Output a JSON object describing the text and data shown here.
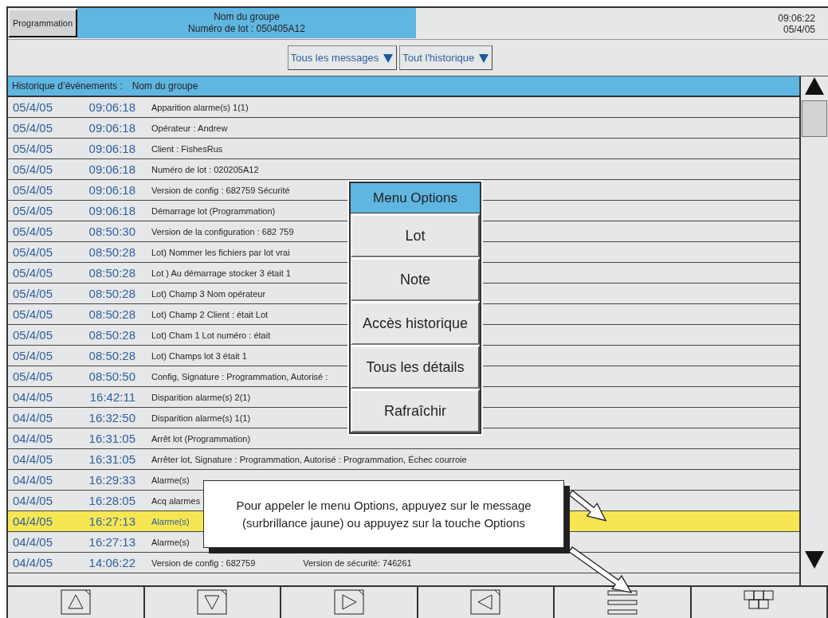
{
  "header": {
    "program_button": "Programmation",
    "group_name": "Nom du groupe",
    "batch_number": "Numéro de lot : 050405A12",
    "time": "09:06:22",
    "date": "05/4/05"
  },
  "filters": [
    {
      "label": "Tous les messages"
    },
    {
      "label": "Tout l'historique"
    }
  ],
  "table": {
    "title": "Historique d’événements :",
    "group": "Nom du groupe",
    "rows": [
      {
        "date": "05/4/05",
        "time": "09:06:18",
        "message": "Apparition alarme(s) 1(1)",
        "selected": false
      },
      {
        "date": "05/4/05",
        "time": "09:06:18",
        "message": "Opérateur : Andrew",
        "selected": false
      },
      {
        "date": "05/4/05",
        "time": "09:06:18",
        "message": "Client : FishesRus",
        "selected": false
      },
      {
        "date": "05/4/05",
        "time": "09:06:18",
        "message": "Numéro de lot : 020205A12",
        "selected": false
      },
      {
        "date": "05/4/05",
        "time": "09:06:18",
        "message": "Version de config : 682759 Sécurité",
        "selected": false
      },
      {
        "date": "05/4/05",
        "time": "09:06:18",
        "message": "Démarrage lot (Programmation)",
        "selected": false
      },
      {
        "date": "05/4/05",
        "time": "08:50:30",
        "message": "Version de la configuration : 682 759",
        "selected": false
      },
      {
        "date": "05/4/05",
        "time": "08:50:28",
        "message": "Lot) Nommer les fichiers par lot vrai",
        "selected": false
      },
      {
        "date": "05/4/05",
        "time": "08:50:28",
        "message": "Lot ) Au démarrage stocker 3 était 1",
        "selected": false
      },
      {
        "date": "05/4/05",
        "time": "08:50:28",
        "message": "Lot) Champ 3 Nom opérateur",
        "selected": false
      },
      {
        "date": "05/4/05",
        "time": "08:50:28",
        "message": "Lot) Champ 2 Client : était Lot",
        "selected": false
      },
      {
        "date": "05/4/05",
        "time": "08:50:28",
        "message": "Lot) Cham 1 Lot numéro : était",
        "selected": false
      },
      {
        "date": "05/4/05",
        "time": "08:50:28",
        "message": "Lot) Champs lot 3 était 1",
        "selected": false
      },
      {
        "date": "05/4/05",
        "time": "08:50:50",
        "message": "Config, Signature : Programmation, Autorisé :",
        "selected": false
      },
      {
        "date": "04/4/05",
        "time": "16:42:11",
        "message": "Disparition alarme(s) 2(1)",
        "selected": false
      },
      {
        "date": "04/4/05",
        "time": "16:32:50",
        "message": "Disparition alarme(s) 1(1)",
        "selected": false
      },
      {
        "date": "04/4/05",
        "time": "16:31:05",
        "message": "Arrêt lot (Programmation)",
        "selected": false
      },
      {
        "date": "04/4/05",
        "time": "16:31:05",
        "message": "Arrêter lot, Signature : Programmation, Autorisé : Programmation, Échec courroie",
        "selected": false
      },
      {
        "date": "04/4/05",
        "time": "16:29:33",
        "message": "Alarme(s)",
        "selected": false
      },
      {
        "date": "04/4/05",
        "time": "16:28:05",
        "message": "Acq alarmes",
        "selected": false
      },
      {
        "date": "04/4/05",
        "time": "16:27:13",
        "message": "Alarme(s)",
        "selected": true
      },
      {
        "date": "04/4/05",
        "time": "16:27:13",
        "message": "Alarme(s)",
        "selected": false
      },
      {
        "date": "04/4/05",
        "time": "14:06:22",
        "message": "Version de config : 682759",
        "extra": "Version de sécurité: 746261",
        "selected": false
      }
    ]
  },
  "options_menu": {
    "title": "Menu Options",
    "items": [
      "Lot",
      "Note",
      "Accès historique",
      "Tous les détails",
      "Rafraîchir"
    ]
  },
  "callout": {
    "text": "Pour appeler le menu Options, appuyez sur le message (surbrillance jaune) ou appuyez sur la touche Options"
  },
  "toolbar": [
    {
      "kind": "up"
    },
    {
      "kind": "down"
    },
    {
      "kind": "right"
    },
    {
      "kind": "left"
    },
    {
      "kind": "menu"
    },
    {
      "kind": "grid"
    }
  ]
}
